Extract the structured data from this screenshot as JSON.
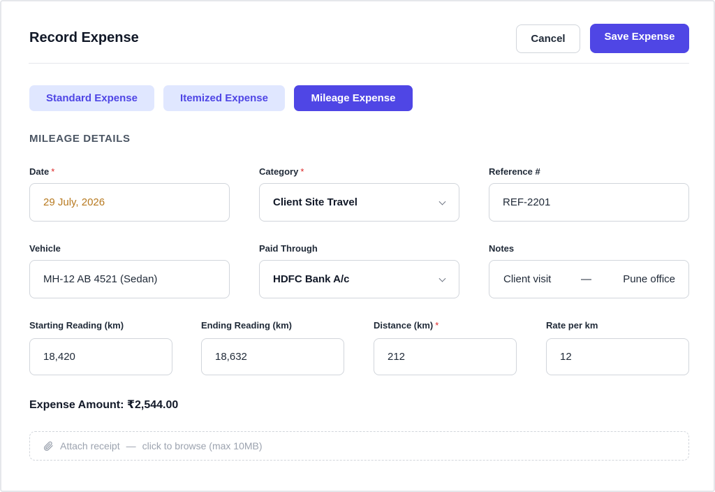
{
  "header": {
    "title": "Record Expense",
    "cancel_label": "Cancel",
    "save_label": "Save Expense"
  },
  "tabs": [
    {
      "label": "Standard Expense",
      "active": false
    },
    {
      "label": "Itemized Expense",
      "active": false
    },
    {
      "label": "Mileage Expense",
      "active": true
    }
  ],
  "section": {
    "heading": "MILEAGE DETAILS"
  },
  "fields": {
    "date": {
      "label": "Date",
      "required": "*",
      "value": "29 July, 2026"
    },
    "category": {
      "label": "Category",
      "required": "*",
      "value": "Client Site Travel"
    },
    "reference": {
      "label": "Reference #",
      "value": "REF-2201"
    },
    "vehicle": {
      "label": "Vehicle",
      "value": "MH-12 AB 4521 (Sedan)"
    },
    "paid_through": {
      "label": "Paid Through",
      "value": "HDFC Bank A/c"
    },
    "notes": {
      "label": "Notes",
      "value_part1": "Client visit",
      "separator": "—",
      "value_part2": "Pune office"
    },
    "starting_reading": {
      "label": "Starting Reading (km)",
      "value": "18,420"
    },
    "ending_reading": {
      "label": "Ending Reading (km)",
      "value": "18,632"
    },
    "distance": {
      "label": "Distance (km)",
      "required": "*",
      "value": "212"
    },
    "rate": {
      "label": "Rate per km",
      "value": "12"
    }
  },
  "amount": {
    "text": "Expense Amount: ₹2,544.00"
  },
  "attachment": {
    "label": "Attach receipt",
    "separator": "—",
    "hint": "click to browse (max 10MB)"
  },
  "colors": {
    "accent": "#4f46e5",
    "accent_light": "#e0e7ff",
    "required": "#dc2626",
    "date_value": "#b7791f"
  },
  "icons": [
    "chevron-down-icon",
    "paperclip-icon"
  ]
}
